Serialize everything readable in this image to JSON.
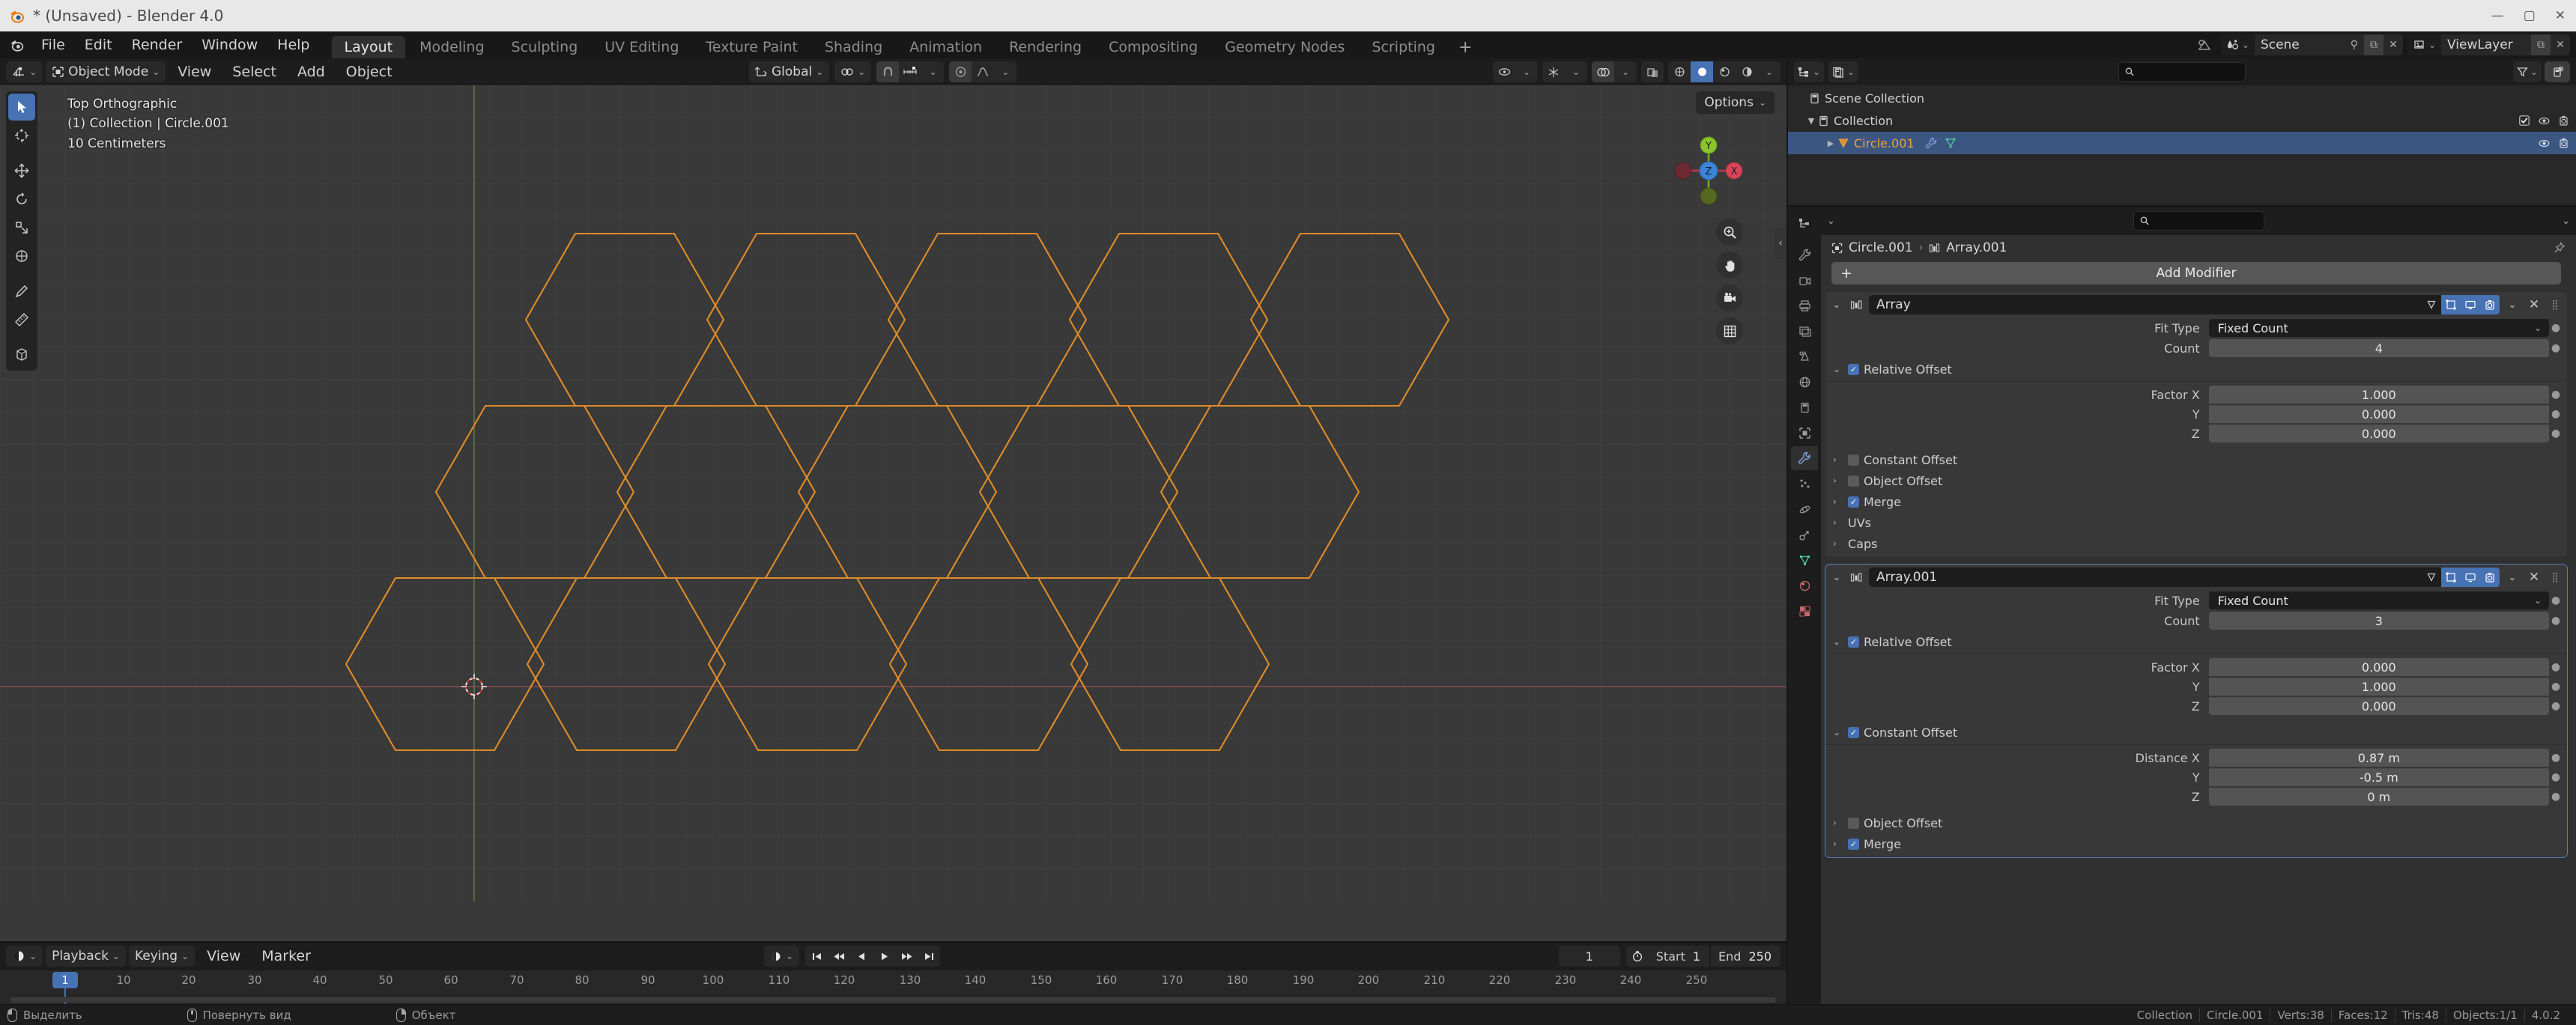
{
  "window": {
    "title": "* (Unsaved) - Blender 4.0",
    "app_icon": "blender-logo-icon",
    "controls": [
      "minimize",
      "maximize",
      "close"
    ]
  },
  "topbar": {
    "menus": [
      "File",
      "Edit",
      "Render",
      "Window",
      "Help"
    ],
    "workspaces": [
      {
        "label": "Layout",
        "active": true
      },
      {
        "label": "Modeling",
        "active": false
      },
      {
        "label": "Sculpting",
        "active": false
      },
      {
        "label": "UV Editing",
        "active": false
      },
      {
        "label": "Texture Paint",
        "active": false
      },
      {
        "label": "Shading",
        "active": false
      },
      {
        "label": "Animation",
        "active": false
      },
      {
        "label": "Rendering",
        "active": false
      },
      {
        "label": "Compositing",
        "active": false
      },
      {
        "label": "Geometry Nodes",
        "active": false
      },
      {
        "label": "Scripting",
        "active": false
      }
    ],
    "add_workspace": "+",
    "scene_name": "Scene",
    "viewlayer_name": "ViewLayer"
  },
  "viewport": {
    "header": {
      "editor_type_icon": "editor-type-3dview-icon",
      "mode": "Object Mode",
      "menus": [
        "View",
        "Select",
        "Add",
        "Object"
      ],
      "transform_orientation": "Global",
      "snap_icon": "magnet-icon",
      "proportional_icon": "proportional-edit-icon"
    },
    "overlay": {
      "view_name": "Top Orthographic",
      "collection_object": "(1) Collection | Circle.001",
      "grid_scale": "10 Centimeters"
    },
    "options_label": "Options",
    "gizmo_axes": [
      {
        "label": "Z",
        "color": "#3b85d8"
      },
      {
        "label": "Y",
        "color": "#8bc52b"
      },
      {
        "label": "X",
        "color": "#d8455a"
      }
    ],
    "nav_buttons": [
      "zoom-icon",
      "pan-hand-icon",
      "camera-view-icon",
      "toggle-ortho-grid-icon"
    ],
    "tools": [
      {
        "name": "tweak-select-tool",
        "active": true
      },
      {
        "name": "cursor-tool",
        "active": false
      },
      {
        "name": "move-tool",
        "active": false
      },
      {
        "name": "rotate-tool",
        "active": false
      },
      {
        "name": "scale-tool",
        "active": false
      },
      {
        "name": "transform-tool",
        "active": false
      },
      {
        "name": "annotate-tool",
        "active": false
      },
      {
        "name": "measure-tool",
        "active": false
      },
      {
        "name": "add-cube-tool",
        "active": false
      }
    ],
    "mesh_color": "#e08c28"
  },
  "outliner": {
    "display_mode_icon": "outliner-display-mode-icon",
    "filter_id_icon": "outliner-id-type-icon",
    "search_placeholder": "",
    "filter_icon": "filter-funnel-icon",
    "new_collection_icon": "new-collection-icon",
    "rows": [
      {
        "label": "Scene Collection",
        "icon": "scene-collection-icon",
        "indent": 0,
        "selected": false,
        "expandable": false,
        "restrict": []
      },
      {
        "label": "Collection",
        "icon": "collection-icon",
        "indent": 1,
        "selected": false,
        "expandable": true,
        "expanded": true,
        "restrict": [
          "checkbox-on",
          "eye-icon",
          "camera-icon"
        ]
      },
      {
        "label": "Circle.001",
        "icon": "mesh-object-icon",
        "indent": 2,
        "selected": true,
        "expandable": true,
        "expanded": false,
        "restrict": [
          "eye-icon",
          "camera-icon"
        ],
        "extra_icons": [
          "modifier-wrench-icon",
          "mesh-data-icon"
        ]
      }
    ]
  },
  "properties": {
    "search_placeholder": "",
    "breadcrumb": [
      {
        "label": "Circle.001",
        "icon": "object-icon"
      },
      {
        "label": "Array.001",
        "icon": "modifier-icon"
      }
    ],
    "pin_icon": "pin-icon",
    "tabs": [
      {
        "name": "tool-tab",
        "icon": "tool-icon",
        "active": false
      },
      {
        "name": "render-tab",
        "icon": "render-camera-icon",
        "active": false
      },
      {
        "name": "output-tab",
        "icon": "printer-icon",
        "active": false
      },
      {
        "name": "viewlayer-tab",
        "icon": "images-icon",
        "active": false
      },
      {
        "name": "scene-tab",
        "icon": "scene-cone-icon",
        "active": false
      },
      {
        "name": "world-tab",
        "icon": "world-globe-icon",
        "active": false
      },
      {
        "name": "collection-tab",
        "icon": "collection-box-icon",
        "active": false
      },
      {
        "name": "object-tab",
        "icon": "object-square-icon",
        "active": false
      },
      {
        "name": "modifier-tab",
        "icon": "wrench-icon",
        "active": true
      },
      {
        "name": "particles-tab",
        "icon": "particles-icon",
        "active": false
      },
      {
        "name": "physics-tab",
        "icon": "physics-orbit-icon",
        "active": false
      },
      {
        "name": "constraints-tab",
        "icon": "constraint-icon",
        "active": false
      },
      {
        "name": "data-tab",
        "icon": "mesh-data-triangle-icon",
        "active": false
      },
      {
        "name": "material-tab",
        "icon": "material-sphere-icon",
        "active": false
      },
      {
        "name": "texture-tab",
        "icon": "texture-checker-icon",
        "active": false
      }
    ],
    "add_modifier_label": "Add Modifier",
    "modifiers": [
      {
        "name": "Array",
        "selected": false,
        "header_toggles": [
          {
            "name": "on-cage-toggle",
            "on": false
          },
          {
            "name": "edit-mode-toggle",
            "on": true
          },
          {
            "name": "realtime-toggle",
            "on": true
          },
          {
            "name": "render-toggle",
            "on": true
          }
        ],
        "fit_type_label": "Fit Type",
        "fit_type_value": "Fixed Count",
        "count_label": "Count",
        "count_value": "4",
        "sections": [
          {
            "label": "Relative Offset",
            "checkbox": true,
            "expanded": true,
            "fields": [
              {
                "label": "Factor X",
                "value": "1.000"
              },
              {
                "label": "Y",
                "value": "0.000"
              },
              {
                "label": "Z",
                "value": "0.000"
              }
            ]
          },
          {
            "label": "Constant Offset",
            "checkbox": false,
            "expanded": false,
            "fields": []
          },
          {
            "label": "Object Offset",
            "checkbox": false,
            "expanded": false,
            "fields": []
          },
          {
            "label": "Merge",
            "checkbox": true,
            "expanded": false,
            "fields": []
          },
          {
            "label": "UVs",
            "checkbox": null,
            "expanded": false,
            "fields": []
          },
          {
            "label": "Caps",
            "checkbox": null,
            "expanded": false,
            "fields": []
          }
        ]
      },
      {
        "name": "Array.001",
        "selected": true,
        "header_toggles": [
          {
            "name": "on-cage-toggle",
            "on": false
          },
          {
            "name": "edit-mode-toggle",
            "on": true
          },
          {
            "name": "realtime-toggle",
            "on": true
          },
          {
            "name": "render-toggle",
            "on": true
          }
        ],
        "fit_type_label": "Fit Type",
        "fit_type_value": "Fixed Count",
        "count_label": "Count",
        "count_value": "3",
        "sections": [
          {
            "label": "Relative Offset",
            "checkbox": true,
            "expanded": true,
            "fields": [
              {
                "label": "Factor X",
                "value": "0.000"
              },
              {
                "label": "Y",
                "value": "1.000"
              },
              {
                "label": "Z",
                "value": "0.000"
              }
            ]
          },
          {
            "label": "Constant Offset",
            "checkbox": true,
            "expanded": true,
            "fields": [
              {
                "label": "Distance X",
                "value": "0.87 m"
              },
              {
                "label": "Y",
                "value": "-0.5 m"
              },
              {
                "label": "Z",
                "value": "0 m"
              }
            ]
          },
          {
            "label": "Object Offset",
            "checkbox": false,
            "expanded": false,
            "fields": []
          },
          {
            "label": "Merge",
            "checkbox": true,
            "expanded": false,
            "fields": []
          }
        ]
      }
    ]
  },
  "timeline": {
    "editor_icon": "timeline-editor-icon",
    "menus": [
      "Playback",
      "Keying",
      "View",
      "Marker"
    ],
    "record_icon": "auto-key-record-icon",
    "transport": [
      "jump-start-icon",
      "prev-keyframe-icon",
      "play-reverse-icon",
      "play-icon",
      "next-keyframe-icon",
      "jump-end-icon"
    ],
    "current_frame": "1",
    "timer_icon": "stopwatch-icon",
    "start_label": "Start",
    "start_value": "1",
    "end_label": "End",
    "end_value": "250",
    "playhead_frame": "1",
    "ticks": [
      10,
      20,
      30,
      40,
      50,
      60,
      70,
      80,
      90,
      100,
      110,
      120,
      130,
      140,
      150,
      160,
      170,
      180,
      190,
      200,
      210,
      220,
      230,
      240,
      250
    ]
  },
  "statusbar": {
    "keymap_hints": [
      {
        "mouse": "lmb",
        "label": "Выделить"
      },
      {
        "mouse": "mmb",
        "label": "Повернуть вид"
      },
      {
        "mouse": "rmb",
        "label": "Объект"
      }
    ],
    "stats": [
      "Collection",
      "Circle.001",
      "Verts:38",
      "Faces:12",
      "Tris:48",
      "Objects:1/1",
      "4.0.2"
    ]
  },
  "colors": {
    "accent_blue": "#4772b3",
    "mesh_orange": "#e08c28",
    "selected_row": "#3b5681",
    "panel_bg": "#303030",
    "viewport_bg": "#393939"
  }
}
